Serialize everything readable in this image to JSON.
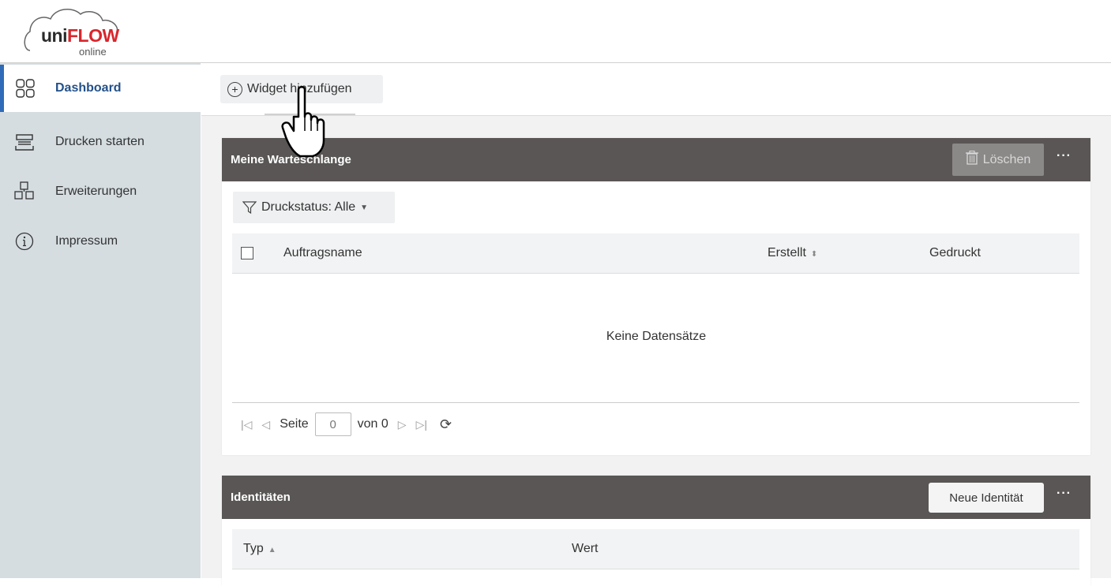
{
  "app": {
    "logo": {
      "brand_uni": "uni",
      "brand_flow": "FLOW",
      "brand_sub": "online"
    }
  },
  "sidebar": {
    "items": [
      {
        "label": "Dashboard",
        "icon": "dashboard-grid-icon",
        "active": true
      },
      {
        "label": "Drucken starten",
        "icon": "printer-tray-icon",
        "active": false
      },
      {
        "label": "Erweiterungen",
        "icon": "extensions-cubes-icon",
        "active": false
      },
      {
        "label": "Impressum",
        "icon": "info-circle-icon",
        "active": false
      }
    ]
  },
  "toolbar": {
    "add_widget_label": "Widget hinzufügen"
  },
  "queue_widget": {
    "title": "Meine Warteschlange",
    "delete_label": "Löschen",
    "more_label": "···",
    "filter_label": "Druckstatus: Alle",
    "columns": [
      "Auftragsname",
      "Erstellt",
      "Gedruckt"
    ],
    "empty_message": "Keine Datensätze",
    "pager": {
      "page_label": "Seite",
      "page_value": "0",
      "of_label": "von 0"
    }
  },
  "identities_widget": {
    "title": "Identitäten",
    "new_identity_label": "Neue Identität",
    "more_label": "···",
    "columns": [
      "Typ",
      "Wert"
    ]
  },
  "colors": {
    "sidebar_bg": "#d5dde1",
    "active_accent": "#2f6bb8",
    "card_header_bg": "#595655",
    "brand_red": "#d8262c"
  }
}
